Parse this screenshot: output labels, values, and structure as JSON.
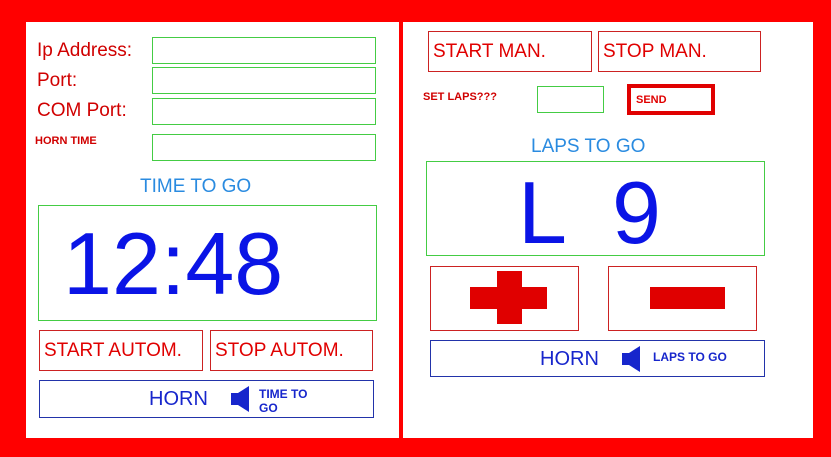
{
  "config": {
    "ip_label": "Ip Address:",
    "ip_value": "",
    "port_label": "Port:",
    "port_value": "",
    "com_label": "COM Port:",
    "com_value": "",
    "horn_time_label": "HORN TIME",
    "horn_time_value": ""
  },
  "time_section": {
    "title": "TIME TO GO",
    "display": "12:48",
    "start_button": "START  AUTOM.",
    "stop_button": "STOP  AUTOM.",
    "horn_button": "HORN",
    "horn_caption": "TIME TO GO"
  },
  "laps_section": {
    "start_button": "START  MAN.",
    "stop_button": "STOP  MAN.",
    "set_laps_label": "SET LAPS???",
    "set_laps_value": "",
    "send_button": "SEND",
    "title": "LAPS TO GO",
    "display_prefix": "L",
    "display_count": "9",
    "plus_icon": "plus-icon",
    "minus_icon": "minus-icon",
    "horn_button": "HORN",
    "horn_caption": "LAPS TO GO"
  },
  "colors": {
    "background": "#ff0000",
    "accent_red": "#e00000",
    "digits_blue": "#0a14e6",
    "title_blue": "#2a8be0",
    "field_border": "#44cc44"
  },
  "icons": {
    "speaker": "speaker-icon"
  }
}
